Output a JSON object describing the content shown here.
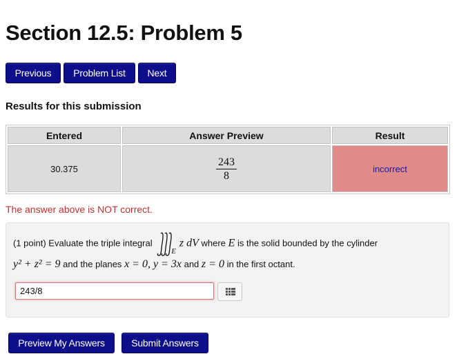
{
  "page": {
    "title": "Section 12.5: Problem 5"
  },
  "nav": {
    "previous": "Previous",
    "problem_list": "Problem List",
    "next": "Next"
  },
  "results": {
    "heading": "Results for this submission",
    "columns": [
      "Entered",
      "Answer Preview",
      "Result"
    ],
    "row": {
      "entered": "30.375",
      "preview_numerator": "243",
      "preview_denominator": "8",
      "result": "incorrect"
    }
  },
  "message": {
    "not_correct": "The answer above is NOT correct."
  },
  "problem": {
    "points": "(1 point) Evaluate the triple integral",
    "integrand": "z dV",
    "region_label": "E",
    "text1": "where",
    "E": "E",
    "text2": "is the solid bounded by the cylinder",
    "eq_cylinder_left": "y² + z² = 9",
    "text3": "and the planes",
    "eq_planes": "x = 0, y = 3x",
    "text4": "and",
    "eq_z": "z = 0",
    "text5": "in the first octant.",
    "answer_value": "243/8"
  },
  "actions": {
    "preview": "Preview My Answers",
    "submit": "Submit Answers"
  },
  "colors": {
    "button": "#0e0e8a",
    "incorrect_bg": "#e08a8a",
    "warning": "#c0312f"
  },
  "icons": {
    "palette": "keypad-grid-icon"
  }
}
